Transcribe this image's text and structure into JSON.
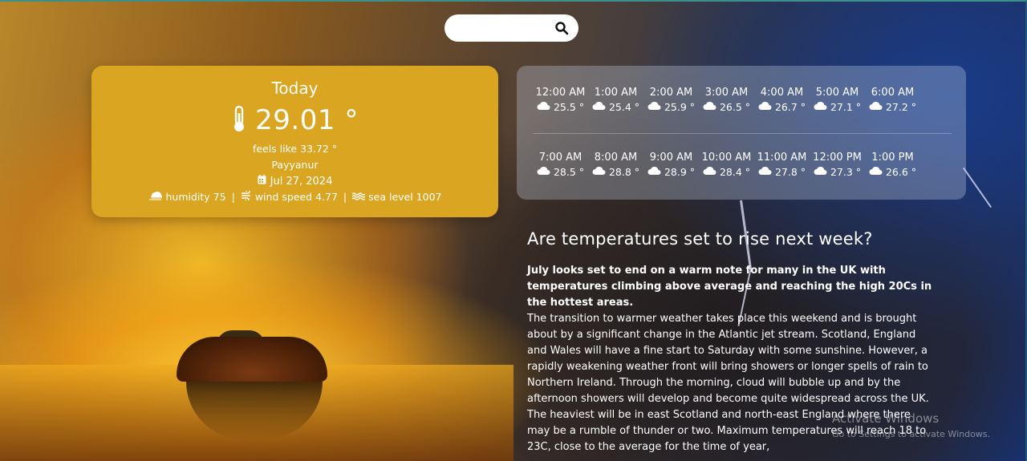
{
  "search": {
    "placeholder": "",
    "value": ""
  },
  "today": {
    "title": "Today",
    "temperature": "29.01 °",
    "feels_like": "feels like 33.72 °",
    "city": "Payyanur",
    "date": "Jul 27, 2024",
    "humidity": "humidity 75",
    "wind": "wind speed 4.77",
    "sea_level": "sea level 1007",
    "separator": "|"
  },
  "hourly": {
    "row1": [
      {
        "time": "12:00 AM",
        "temp": "25.5 °"
      },
      {
        "time": "1:00 AM",
        "temp": "25.4 °"
      },
      {
        "time": "2:00 AM",
        "temp": "25.9 °"
      },
      {
        "time": "3:00 AM",
        "temp": "26.5 °"
      },
      {
        "time": "4:00 AM",
        "temp": "26.7 °"
      },
      {
        "time": "5:00 AM",
        "temp": "27.1 °"
      },
      {
        "time": "6:00 AM",
        "temp": "27.2 °"
      }
    ],
    "row2": [
      {
        "time": "7:00 AM",
        "temp": "28.5 °"
      },
      {
        "time": "8:00 AM",
        "temp": "28.8 °"
      },
      {
        "time": "9:00 AM",
        "temp": "28.9 °"
      },
      {
        "time": "10:00 AM",
        "temp": "28.4 °"
      },
      {
        "time": "11:00 AM",
        "temp": "27.8 °"
      },
      {
        "time": "12:00 PM",
        "temp": "27.3 °"
      },
      {
        "time": "1:00 PM",
        "temp": "26.6 °"
      }
    ]
  },
  "article": {
    "title": "Are temperatures set to rise next week?",
    "lead": "July looks set to end on a warm note for many in the UK with temperatures climbing above average and reaching the high 20Cs in the hottest areas.",
    "body": "The transition to warmer weather takes place this weekend and is brought about by a significant change in the Atlantic jet stream. Scotland, England and Wales will have a fine start to Saturday with some sunshine. However, a rapidly weakening weather front will bring showers or longer spells of rain to Northern Ireland. Through the morning, cloud will bubble up and by the afternoon showers will develop and become quite widespread across the UK. The heaviest will be in east Scotland and north-east England where there may be a rumble of thunder or two. Maximum temperatures will reach 18 to 23C, close to the average for the time of year,"
  },
  "watermark": {
    "title": "Activate Windows",
    "subtitle": "Go to Settings to activate Windows."
  },
  "colors": {
    "today_card": "#daa520",
    "top_line": "#3d8f8c"
  },
  "icons": {
    "search": "magnifier-icon",
    "temperature": "thermometer-icon",
    "date": "calendar-icon",
    "humidity": "humidity-icon",
    "wind": "wind-icon",
    "sea_level": "water-icon",
    "hourly": "cloud-icon"
  }
}
